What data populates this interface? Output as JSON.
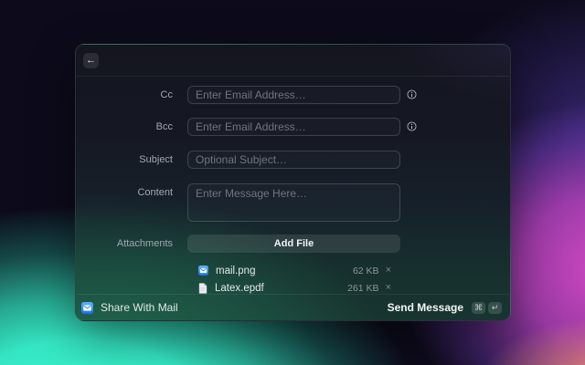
{
  "window": {
    "header": {
      "back_icon": "←"
    },
    "form": {
      "fields": [
        {
          "label": "Cc",
          "placeholder": "Enter Email Address…",
          "value": "",
          "has_info": true
        },
        {
          "label": "Bcc",
          "placeholder": "Enter Email Address…",
          "value": "",
          "has_info": true
        },
        {
          "label": "Subject",
          "placeholder": "Optional Subject…",
          "value": "",
          "has_info": false
        },
        {
          "label": "Content",
          "placeholder": "Enter Message Here…",
          "value": "",
          "has_info": false
        }
      ],
      "attachments": {
        "label": "Attachments",
        "add_button_label": "Add File",
        "files": [
          {
            "name": "mail.png",
            "size": "62 KB",
            "icon": "mail-app-icon",
            "remove_icon": "×"
          },
          {
            "name": "Latex.epdf",
            "size": "261 KB",
            "icon": "document-icon",
            "remove_icon": "×"
          }
        ]
      }
    },
    "footer": {
      "app_icon": "mail-app-icon",
      "app_name": "Share With Mail",
      "primary_action_label": "Send Message",
      "shortcut_keys": [
        "⌘",
        "↵"
      ]
    }
  },
  "colors": {
    "accent_blue": "#2f8ef5",
    "background_navy": "#0d0b1b",
    "background_mint": "#3ef5cb",
    "background_magenta": "#d94fd2",
    "background_salmon": "#ef8f70",
    "window_green_tint": "#2cbe80"
  }
}
